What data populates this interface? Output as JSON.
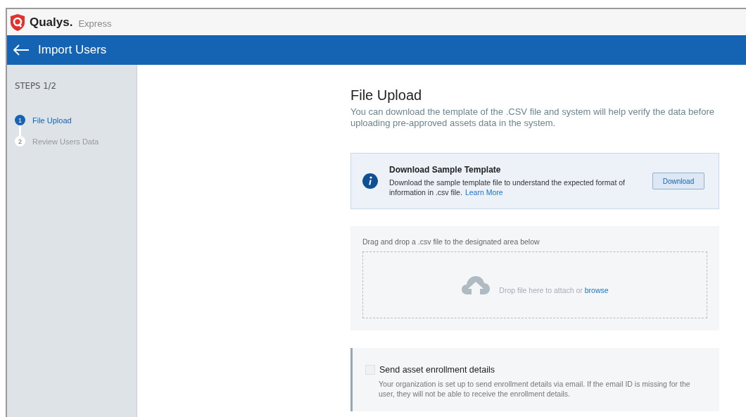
{
  "brand": {
    "name": "Qualys.",
    "product": "Express"
  },
  "title_bar": {
    "title": "Import Users"
  },
  "sidebar": {
    "heading": "STEPS 1/2",
    "steps": [
      {
        "number": "1",
        "label": "File Upload",
        "selected": true
      },
      {
        "number": "2",
        "label": "Review Users Data",
        "selected": false
      }
    ]
  },
  "main": {
    "title": "File Upload",
    "description": "You can download the template of the .CSV file and system will help verify the data before uploading pre-approved assets data in the system.",
    "template_card": {
      "title": "Download Sample Template",
      "text": "Download the sample template file to understand the expected format of information in .csv file.",
      "link": "Learn More",
      "button": "Download"
    },
    "upload": {
      "instruction": "Drag and drop a .csv file to the designated area below",
      "drop_text": "Drop file here to attach or",
      "browse": "browse"
    },
    "enrollment": {
      "label": "Send asset enrollment details",
      "checked": false,
      "text": "Your organization is set up to send enrollment details via email. If the email ID is missing for the user, they will not be able to receive the enrollment details."
    }
  }
}
